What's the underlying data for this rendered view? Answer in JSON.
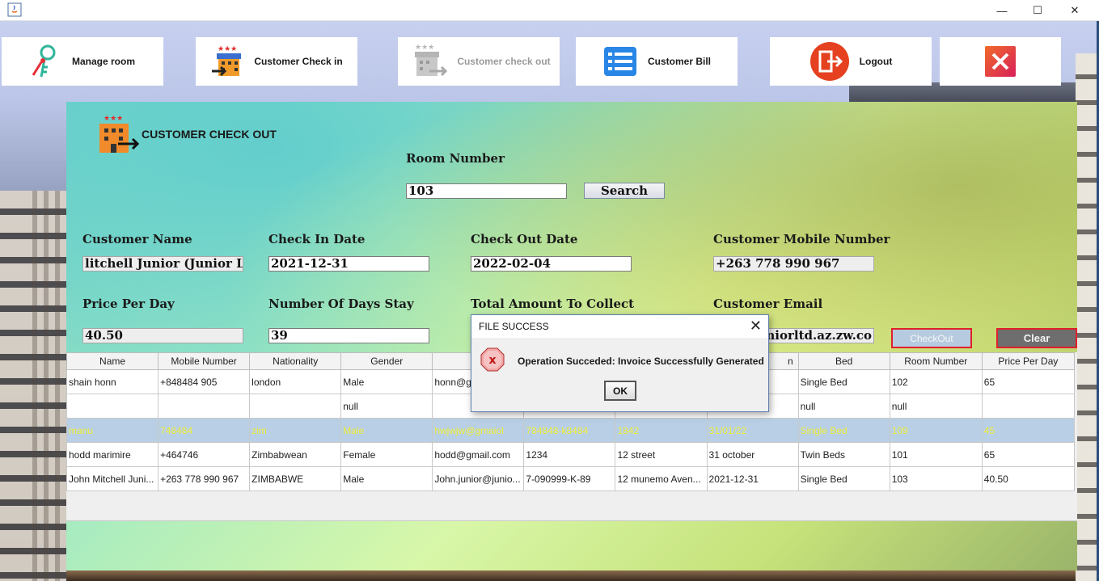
{
  "window": {
    "minimize": "—",
    "maximize": "☐",
    "close": "✕"
  },
  "menu": [
    {
      "label": "Manage room",
      "icon": "key-person-icon",
      "enabled": true
    },
    {
      "label": "Customer Check in",
      "icon": "hotel-checkin-icon",
      "enabled": true
    },
    {
      "label": "Customer check out",
      "icon": "hotel-checkout-icon",
      "enabled": false
    },
    {
      "label": "Customer Bill",
      "icon": "bill-list-icon",
      "enabled": true
    },
    {
      "label": "Logout",
      "icon": "logout-icon",
      "enabled": true
    },
    {
      "label": "",
      "icon": "close-app-icon",
      "enabled": true
    }
  ],
  "form": {
    "title": "CUSTOMER CHECK OUT",
    "room_number_label": "Room Number",
    "room_number_value": "103",
    "search_label": "Search",
    "customer_name_label": "Customer Name",
    "customer_name_value": "litchell Junior (Junior Ltd)",
    "check_in_label": "Check In Date",
    "check_in_value": "2021-12-31",
    "check_out_label": "Check Out Date",
    "check_out_value": "2022-02-04",
    "mobile_label": "Customer Mobile Number",
    "mobile_value": "+263 778 990 967",
    "price_label": "Price Per Day",
    "price_value": "40.50",
    "days_label": "Number Of Days Stay",
    "days_value": "39",
    "total_label": "Total Amount To Collect",
    "email_label": "Customer Email",
    "email_value": "uniorltd.az.zw.co",
    "checkout_label": "CheckOut",
    "clear_label": "Clear"
  },
  "table": {
    "columns": [
      "Name",
      "Mobile Number",
      "Nationality",
      "Gender",
      "E",
      "",
      "",
      "n",
      "Bed",
      "Room Number",
      "Price Per Day"
    ],
    "rows": [
      [
        "shain honn",
        "+848484 905",
        "london",
        "Male",
        "honn@g",
        "",
        "",
        "",
        "Single Bed",
        "102",
        "65"
      ],
      [
        "",
        "",
        "",
        "null",
        "",
        "",
        "",
        "",
        "null",
        "null",
        ""
      ],
      [
        "manu",
        "748484",
        "zim",
        "Male",
        "hwjwjw@gmaiol",
        "784848-k8484",
        "1842",
        "31/01/22",
        "Single Bed",
        "109",
        "45"
      ],
      [
        "hodd marimire",
        "+464746",
        "Zimbabwean",
        "Female",
        "hodd@gmail.com",
        "1234",
        "12 street",
        "31 october",
        "Twin Beds",
        "101",
        "65"
      ],
      [
        "John Mitchell Juni...",
        "+263 778 990 967",
        "ZIMBABWE",
        "Male",
        "John.junior@junio...",
        "7-090999-K-89",
        "12 munemo Aven...",
        "2021-12-31",
        "Single Bed",
        "103",
        "40.50"
      ]
    ],
    "selected_row": 2
  },
  "dialog": {
    "title": "FILE SUCCESS",
    "message": "Operation Succeded: Invoice Successfully Generated",
    "ok_label": "OK",
    "icon": "error-x-icon"
  },
  "colors": {
    "selection_row": "#b8cfe5",
    "selection_text": "#f0ee3a",
    "button_border": "#e0202a"
  }
}
